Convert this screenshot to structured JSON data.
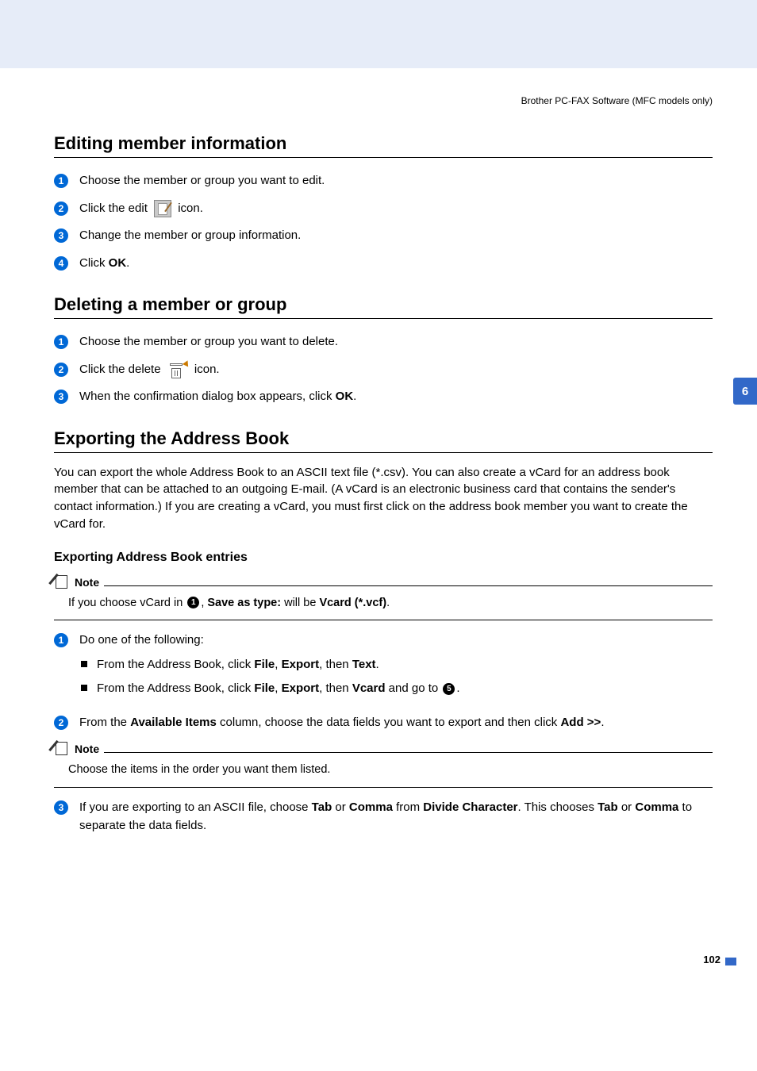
{
  "running_header": "Brother PC-FAX Software (MFC models only)",
  "side_tab": "6",
  "page_number": "102",
  "section_editing": {
    "title": "Editing member information",
    "steps": {
      "1": {
        "n": "1",
        "text": "Choose the member or group you want to edit."
      },
      "2": {
        "n": "2",
        "prefix": "Click the edit ",
        "suffix": " icon."
      },
      "3": {
        "n": "3",
        "text": "Change the member or group information."
      },
      "4": {
        "n": "4",
        "prefix": "Click ",
        "bold": "OK",
        "suffix": "."
      }
    }
  },
  "section_deleting": {
    "title": "Deleting a member or group",
    "steps": {
      "1": {
        "n": "1",
        "text": "Choose the member or group you want to delete."
      },
      "2": {
        "n": "2",
        "prefix": "Click the delete ",
        "suffix": " icon."
      },
      "3": {
        "n": "3",
        "prefix": "When the confirmation dialog box appears, click ",
        "bold": "OK",
        "suffix": "."
      }
    }
  },
  "section_exporting": {
    "title": "Exporting the Address Book",
    "intro": "You can export the whole Address Book to an ASCII text file (*.csv). You can also create a vCard for an address book member that can be attached to an outgoing E-mail. (A vCard is an electronic business card that contains the sender's contact information.) If you are creating a vCard, you must first click on the address book member you want to create the vCard for.",
    "sub_title": "Exporting Address Book entries",
    "note1": {
      "label": "Note",
      "p1": "If you choose vCard in ",
      "ref1": "1",
      "p2": ", ",
      "b1": "Save as type:",
      "p3": " will be ",
      "b2": "Vcard (*.vcf)",
      "p4": "."
    },
    "steps": {
      "1": {
        "n": "1",
        "lead": "Do one of the following:",
        "li1": {
          "p1": "From the Address Book, click ",
          "b1": "File",
          "p2": ", ",
          "b2": "Export",
          "p3": ", then ",
          "b3": "Text",
          "p4": "."
        },
        "li2": {
          "p1": "From the Address Book, click ",
          "b1": "File",
          "p2": ", ",
          "b2": "Export",
          "p3": ", then ",
          "b3": "Vcard",
          "p4": " and go to ",
          "ref": "5",
          "p5": "."
        }
      },
      "2": {
        "n": "2",
        "p1": "From the ",
        "b1": "Available Items",
        "p2": " column, choose the data fields you want to export and then click ",
        "b2": "Add >>",
        "p3": "."
      },
      "3": {
        "n": "3",
        "p1": "If you are exporting to an ASCII file, choose ",
        "b1": "Tab",
        "p2": " or ",
        "b2": "Comma",
        "p3": " from ",
        "b3": "Divide Character",
        "p4": ". This chooses ",
        "b4": "Tab",
        "p5": " or ",
        "b5": "Comma",
        "p6": " to separate the data fields."
      }
    },
    "note2": {
      "label": "Note",
      "text": "Choose the items in the order you want them listed."
    }
  }
}
